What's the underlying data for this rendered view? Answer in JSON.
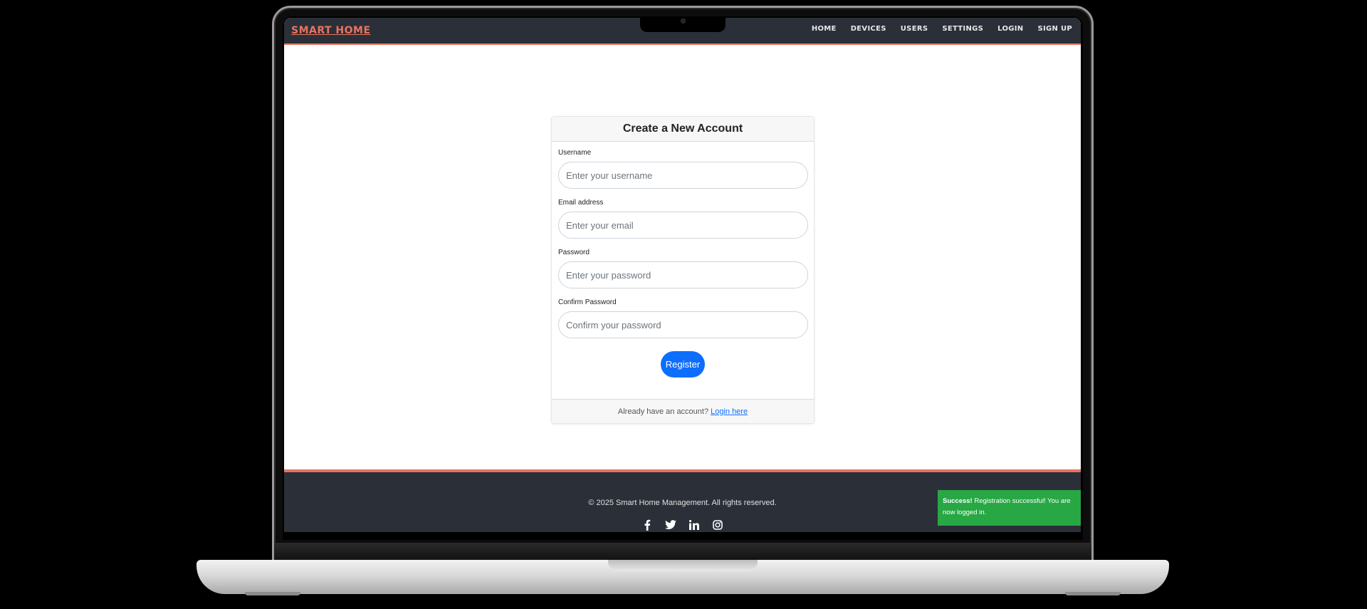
{
  "navbar": {
    "brand": "SMART HOME",
    "links": [
      "HOME",
      "DEVICES",
      "USERS",
      "SETTINGS",
      "LOGIN",
      "SIGN UP"
    ]
  },
  "form": {
    "title": "Create a New Account",
    "username": {
      "label": "Username",
      "placeholder": "Enter your username"
    },
    "email": {
      "label": "Email address",
      "placeholder": "Enter your email"
    },
    "password": {
      "label": "Password",
      "placeholder": "Enter your password"
    },
    "confirm": {
      "label": "Confirm Password",
      "placeholder": "Confirm your password"
    },
    "submit_label": "Register",
    "footer_text": "Already have an account?",
    "login_link": "Login here"
  },
  "footer": {
    "copyright": "© 2025 Smart Home Management. All rights reserved.",
    "socials": [
      "facebook-icon",
      "twitter-icon",
      "linkedin-icon",
      "instagram-icon"
    ]
  },
  "toast": {
    "title": "Success!",
    "message": "Registration successful! You are now logged in."
  },
  "colors": {
    "accent": "#e8735f",
    "nav_bg": "#2b2f38",
    "primary": "#0d6efd",
    "success": "#28a745"
  }
}
